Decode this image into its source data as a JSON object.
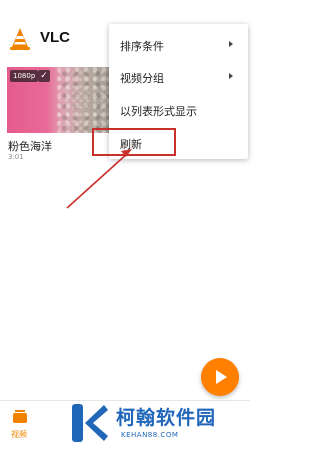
{
  "app": {
    "title": "VLC"
  },
  "video": {
    "resolution_badge": "1080p",
    "check_mark": "✓",
    "title": "粉色海洋",
    "duration": "3:01"
  },
  "menu": {
    "items": [
      {
        "label": "排序条件",
        "has_submenu": true
      },
      {
        "label": "视频分组",
        "has_submenu": true
      },
      {
        "label": "以列表形式显示",
        "has_submenu": false
      },
      {
        "label": "刷新",
        "has_submenu": false,
        "highlighted": true
      }
    ]
  },
  "bottom_nav": {
    "tabs": [
      {
        "label": "视频",
        "icon": "video-folder-icon",
        "active": true
      }
    ]
  },
  "watermark": {
    "title": "柯翰软件园",
    "subtitle": "KEHAN88.COM"
  },
  "colors": {
    "accent": "#ff7f00",
    "highlight": "#c9302c",
    "watermark": "#2066b9"
  },
  "icons": {
    "logo": "vlc-cone-icon",
    "fab": "play-icon"
  }
}
